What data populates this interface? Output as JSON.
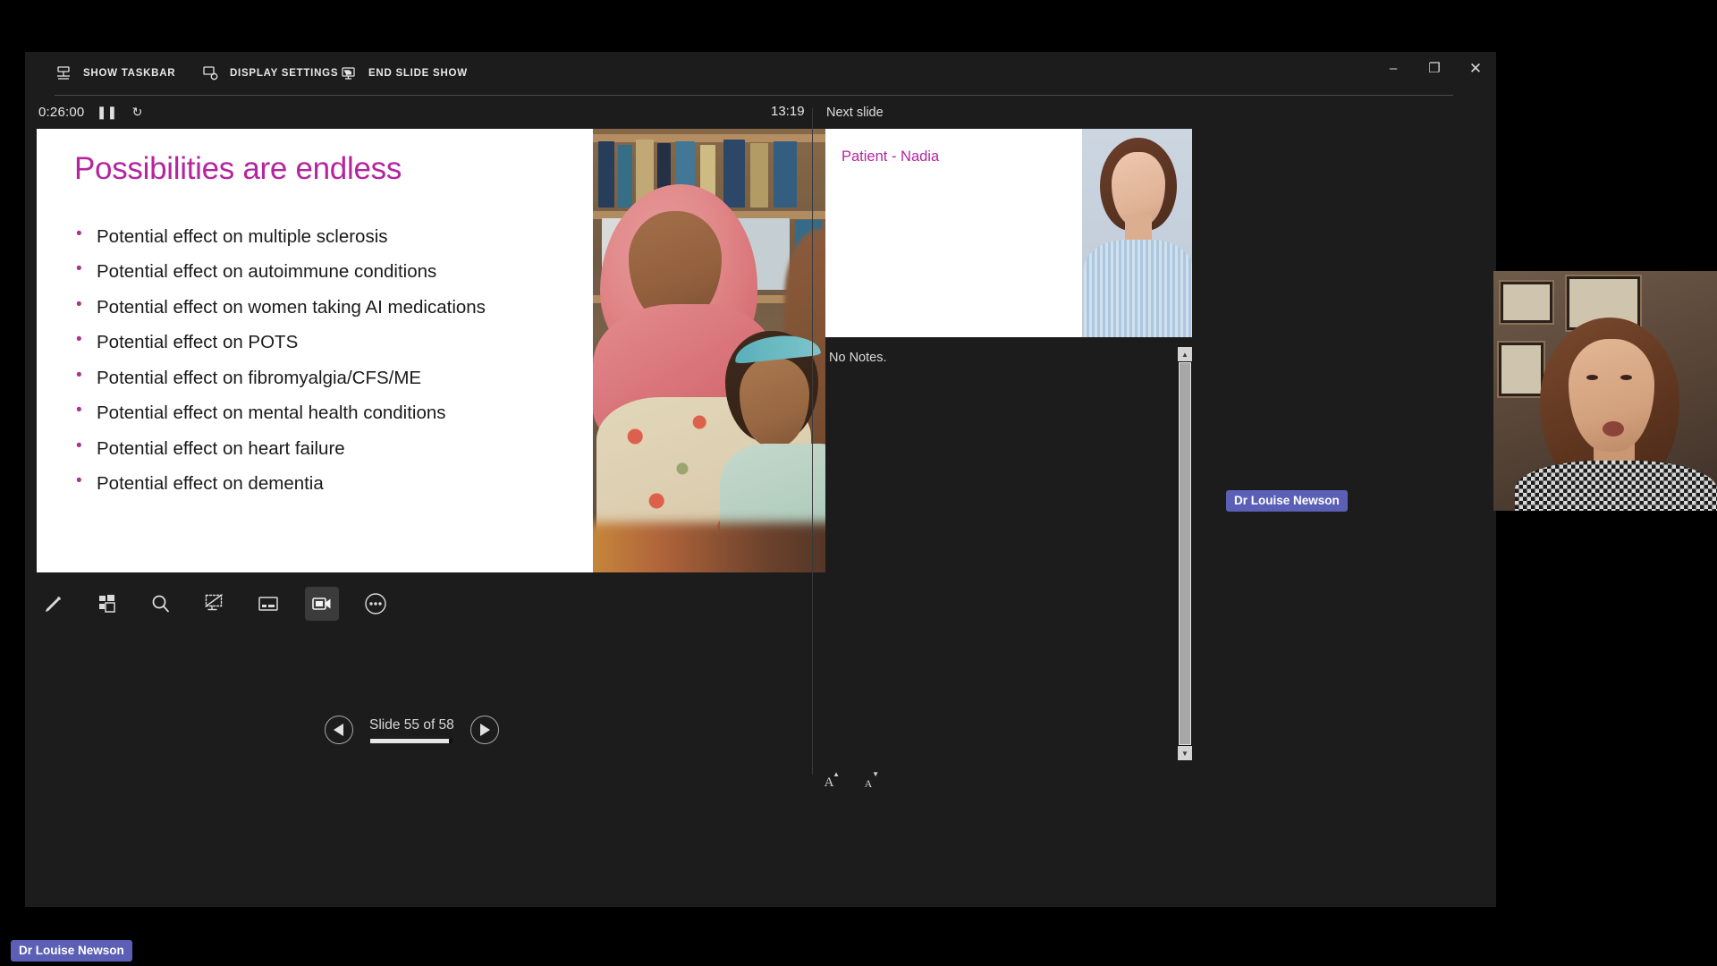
{
  "window": {
    "minimize_label": "–",
    "restore_label": "❐",
    "close_label": "✕"
  },
  "toolbar": {
    "show_taskbar": "SHOW TASKBAR",
    "display_settings": "DISPLAY SETTINGS ▼",
    "end_slide_show": "END SLIDE SHOW"
  },
  "status": {
    "elapsed": "0:26:00",
    "pause_glyph": "❚❚",
    "restart_glyph": "↻",
    "clock": "13:19"
  },
  "slide": {
    "title": "Possibilities are endless",
    "title_color": "#b5259e",
    "bullets": [
      "Potential effect on multiple sclerosis",
      "Potential effect on autoimmune conditions",
      "Potential effect on women taking AI medications",
      "Potential effect on POTS",
      "Potential effect on fibromyalgia/CFS/ME",
      "Potential effect on mental health conditions",
      "Potential effect on heart failure",
      "Potential effect on dementia"
    ]
  },
  "slide_tools": [
    {
      "name": "pen-icon",
      "label": "Pen"
    },
    {
      "name": "all-slides-icon",
      "label": "See all slides"
    },
    {
      "name": "magnifier-icon",
      "label": "Zoom into slide"
    },
    {
      "name": "black-screen-icon",
      "label": "Black or unblack slide show"
    },
    {
      "name": "subtitles-icon",
      "label": "Toggle subtitles"
    },
    {
      "name": "camera-icon",
      "label": "Toggle camera",
      "active": true
    },
    {
      "name": "more-options-icon",
      "label": "More slide show options"
    }
  ],
  "navigation": {
    "counter": "Slide 55 of 58",
    "current": 55,
    "total": 58,
    "progress_percent": 94.8,
    "prev_label": "Previous slide",
    "next_label": "Next slide"
  },
  "right_panel": {
    "next_slide_label": "Next slide",
    "next_slide_title": "Patient - Nadia",
    "notes_text": "No Notes.",
    "font_larger_label": "A",
    "font_larger_arrow": "▲",
    "font_smaller_label": "A",
    "font_smaller_arrow": "▼"
  },
  "participants": {
    "webcam_name": "Dr Louise Newson",
    "self_name": "Dr Louise Newson",
    "badge_color": "#5b5fb5"
  }
}
